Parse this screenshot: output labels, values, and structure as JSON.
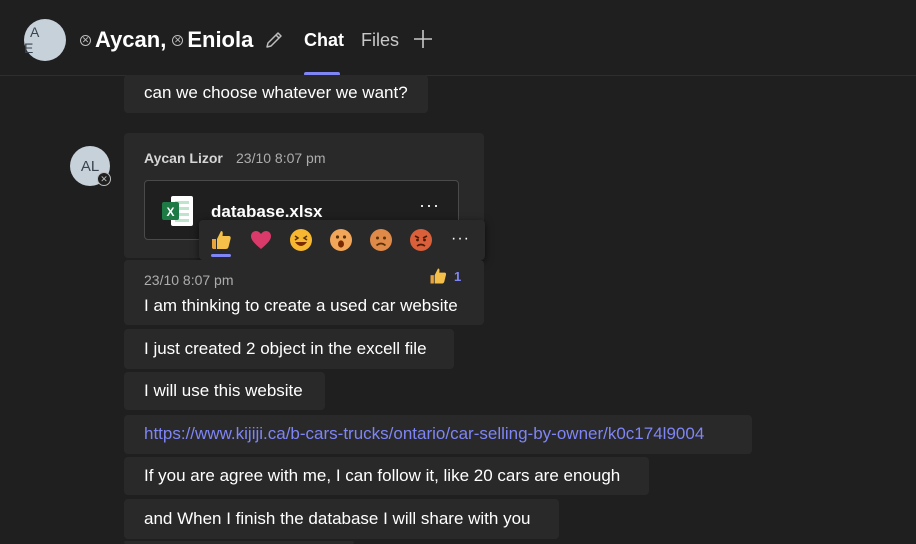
{
  "header": {
    "group_initials": "A E",
    "participants": [
      "Aycan,",
      "Eniola"
    ],
    "tabs": [
      {
        "label": "Chat",
        "active": true
      },
      {
        "label": "Files",
        "active": false
      }
    ],
    "accent_color": "#7f85f5"
  },
  "messages": {
    "prev": "can we choose whatever we want?",
    "sender_initials": "AL",
    "sender_name": "Aycan Lizor",
    "sender_time": "23/10 8:07 pm",
    "file_name": "database.xlsx",
    "file_more": "···",
    "reactions": [
      "like",
      "heart",
      "laugh",
      "surprised",
      "sad",
      "angry"
    ],
    "reactions_more": "···",
    "msg_time": "23/10 8:07 pm",
    "like_count": "1",
    "items": [
      "I am thinking to create a used car website",
      "I just created 2 object in the excell file",
      "I will use this website",
      "https://www.kijiji.ca/b-cars-trucks/ontario/car-selling-by-owner/k0c174l9004",
      "If you are agree with me, I can follow it, like 20 cars are enough",
      "and When I finish the database I will share with you"
    ]
  }
}
